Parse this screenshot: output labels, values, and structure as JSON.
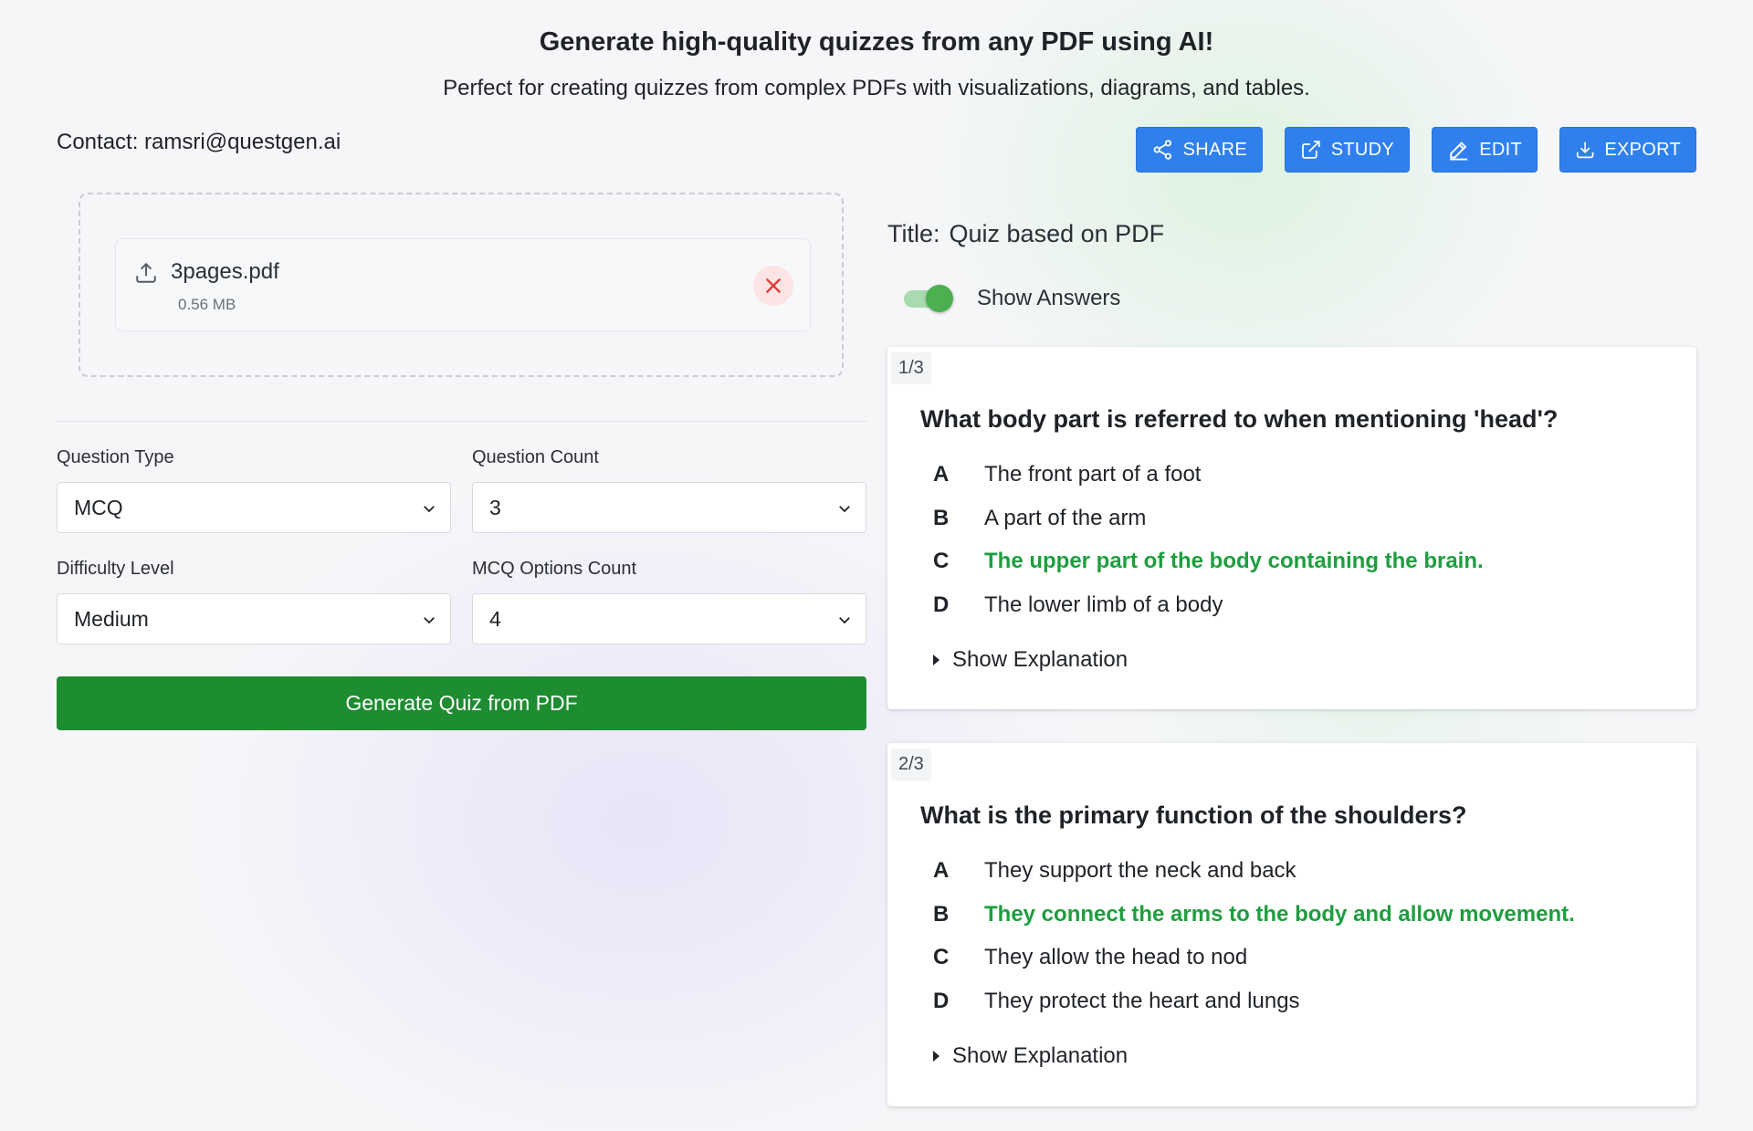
{
  "header": {
    "headline": "Generate high-quality quizzes from any PDF using AI!",
    "subline": "Perfect for creating quizzes from complex PDFs with visualizations, diagrams, and tables.",
    "contact": "Contact: ramsri@questgen.ai"
  },
  "toolbar": {
    "share_label": "SHARE",
    "study_label": "STUDY",
    "edit_label": "EDIT",
    "export_label": "EXPORT",
    "button_color": "#2f80ed",
    "icons": [
      "share-icon",
      "external-link-icon",
      "pencil-icon",
      "download-icon"
    ]
  },
  "upload": {
    "file_name": "3pages.pdf",
    "file_size": "0.56 MB",
    "remove_color": "#e53935"
  },
  "settings": {
    "question_type_label": "Question Type",
    "question_type_value": "MCQ",
    "question_count_label": "Question Count",
    "question_count_value": "3",
    "difficulty_label": "Difficulty Level",
    "difficulty_value": "Medium",
    "mcq_options_label": "MCQ Options Count",
    "mcq_options_value": "4"
  },
  "generate": {
    "label": "Generate Quiz from PDF",
    "color": "#1e8c31"
  },
  "quiz": {
    "title_label": "Title:",
    "title_value": "Quiz based on PDF",
    "show_answers_label": "Show Answers",
    "show_answers_on": true,
    "correct_color": "#1e9e3e",
    "questions": [
      {
        "number": "1/3",
        "text": "What body part is referred to when mentioning 'head'?",
        "options": [
          {
            "letter": "A",
            "text": "The front part of a foot",
            "correct": false
          },
          {
            "letter": "B",
            "text": "A part of the arm",
            "correct": false
          },
          {
            "letter": "C",
            "text": "The upper part of the body containing the brain.",
            "correct": true
          },
          {
            "letter": "D",
            "text": "The lower limb of a body",
            "correct": false
          }
        ],
        "explanation_label": "Show Explanation"
      },
      {
        "number": "2/3",
        "text": "What is the primary function of the shoulders?",
        "options": [
          {
            "letter": "A",
            "text": "They support the neck and back",
            "correct": false
          },
          {
            "letter": "B",
            "text": "They connect the arms to the body and allow movement.",
            "correct": true
          },
          {
            "letter": "C",
            "text": "They allow the head to nod",
            "correct": false
          },
          {
            "letter": "D",
            "text": "They protect the heart and lungs",
            "correct": false
          }
        ],
        "explanation_label": "Show Explanation"
      }
    ]
  }
}
